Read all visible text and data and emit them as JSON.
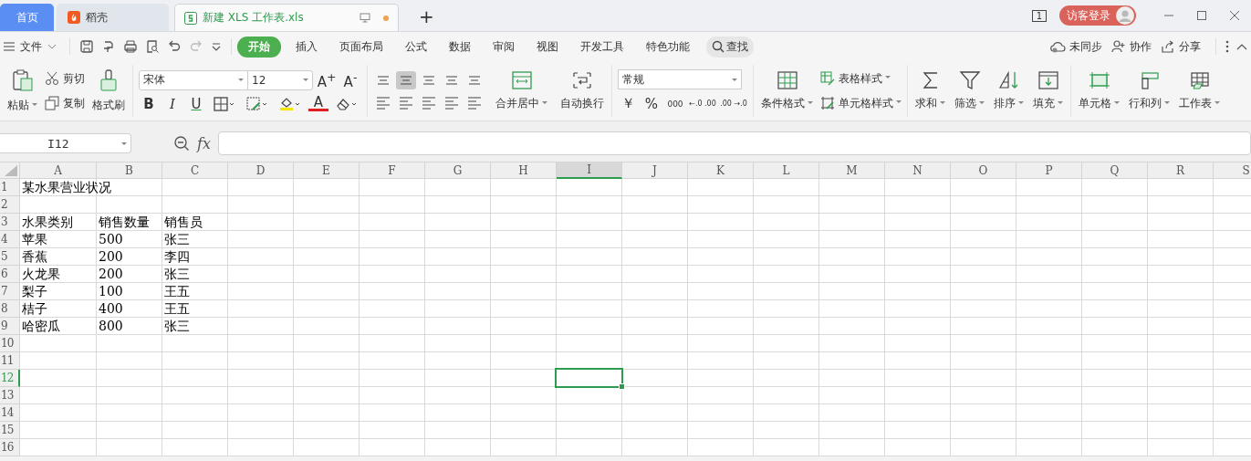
{
  "tabs": [
    {
      "label": "首页",
      "selected": false,
      "kind": "home"
    },
    {
      "label": "稻壳",
      "selected": false,
      "kind": "docer"
    },
    {
      "label": "新建 XLS 工作表.xls",
      "selected": true,
      "kind": "file",
      "unsaved": true
    }
  ],
  "new_tab": "+",
  "window_count": "1",
  "login": "访客登录",
  "menu": {
    "file": "文件",
    "tabs": [
      {
        "label": "开始",
        "selected": true
      },
      {
        "label": "插入",
        "selected": false
      },
      {
        "label": "页面布局",
        "selected": false
      },
      {
        "label": "公式",
        "selected": false
      },
      {
        "label": "数据",
        "selected": false
      },
      {
        "label": "审阅",
        "selected": false
      },
      {
        "label": "视图",
        "selected": false
      },
      {
        "label": "开发工具",
        "selected": false
      },
      {
        "label": "特色功能",
        "selected": false
      }
    ],
    "search": "查找",
    "sync": "未同步",
    "collab": "协作",
    "share": "分享"
  },
  "ribbon": {
    "paste": "粘贴",
    "cut": "剪切",
    "copy": "复制",
    "format_painter": "格式刷",
    "font": "宋体",
    "font_size": "12",
    "grow_font": "A$^{+}$",
    "shrink_font": "A$^{-}$",
    "bold": "B",
    "italic": "I",
    "underline": "U",
    "font_color": "A",
    "merge": "合并居中",
    "wrap": "自动换行",
    "number_format": "常规",
    "currency": "￥",
    "percent": "%",
    "thousands": "000",
    "decimal_up": "←.0 .00",
    "decimal_down": ".00 →.0",
    "cond_format": "条件格式",
    "table_style": "表格样式",
    "cell_style": "单元格样式",
    "sum": "求和",
    "filter": "筛选",
    "sort": "排序",
    "fill": "填充",
    "cells": "单元格",
    "rows_cols": "行和列",
    "worksheet": "工作表"
  },
  "formula_bar": {
    "name_box": "I12",
    "fx": "fx"
  },
  "sheet": {
    "columns": [
      {
        "label": "A",
        "selected": false
      },
      {
        "label": "B",
        "selected": false
      },
      {
        "label": "C",
        "selected": false
      },
      {
        "label": "D",
        "selected": false
      },
      {
        "label": "E",
        "selected": false
      },
      {
        "label": "F",
        "selected": false
      },
      {
        "label": "G",
        "selected": false
      },
      {
        "label": "H",
        "selected": false
      },
      {
        "label": "I",
        "selected": true
      },
      {
        "label": "J",
        "selected": false
      },
      {
        "label": "K",
        "selected": false
      },
      {
        "label": "L",
        "selected": false
      },
      {
        "label": "M",
        "selected": false
      },
      {
        "label": "N",
        "selected": false
      },
      {
        "label": "O",
        "selected": false
      },
      {
        "label": "P",
        "selected": false
      },
      {
        "label": "Q",
        "selected": false
      },
      {
        "label": "R",
        "selected": false
      },
      {
        "label": "S",
        "selected": false
      }
    ],
    "rows": [
      {
        "label": "1",
        "selected": false,
        "cells": [
          "某水果营业状况"
        ]
      },
      {
        "label": "2",
        "selected": false,
        "cells": []
      },
      {
        "label": "3",
        "selected": false,
        "cells": [
          "水果类别",
          "销售数量",
          "销售员"
        ]
      },
      {
        "label": "4",
        "selected": false,
        "cells": [
          "苹果",
          "500",
          "张三"
        ]
      },
      {
        "label": "5",
        "selected": false,
        "cells": [
          "香蕉",
          "200",
          "李四"
        ]
      },
      {
        "label": "6",
        "selected": false,
        "cells": [
          "火龙果",
          "200",
          "张三"
        ]
      },
      {
        "label": "7",
        "selected": false,
        "cells": [
          "梨子",
          "100",
          "王五"
        ]
      },
      {
        "label": "8",
        "selected": false,
        "cells": [
          "桔子",
          "400",
          "王五"
        ]
      },
      {
        "label": "9",
        "selected": false,
        "cells": [
          "哈密瓜",
          "800",
          "张三"
        ]
      },
      {
        "label": "10",
        "selected": false,
        "cells": []
      },
      {
        "label": "11",
        "selected": false,
        "cells": []
      },
      {
        "label": "12",
        "selected": true,
        "cells": []
      },
      {
        "label": "13",
        "selected": false,
        "cells": []
      },
      {
        "label": "14",
        "selected": false,
        "cells": []
      },
      {
        "label": "15",
        "selected": false,
        "cells": []
      },
      {
        "label": "16",
        "selected": false,
        "cells": []
      }
    ]
  }
}
